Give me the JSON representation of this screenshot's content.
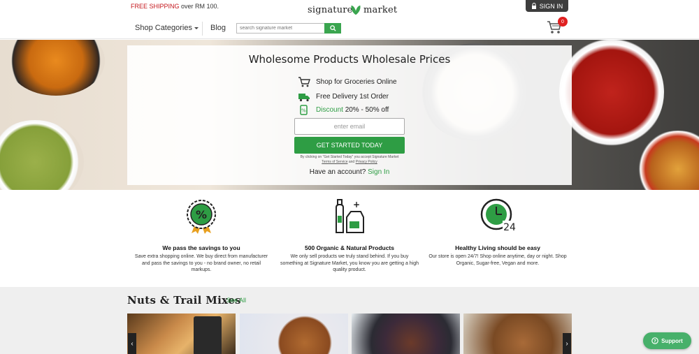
{
  "colors": {
    "brand_green": "#2e9d44",
    "promo_red": "#c4161c",
    "badge_red": "#e02020",
    "dark": "#3d3d3d"
  },
  "header": {
    "promo_prefix": "FREE SHIPPING",
    "promo_suffix": "over RM 100.",
    "logo_left": "signature",
    "logo_right": "market",
    "signin_label": "SIGN IN",
    "categories_label": "Shop Categories",
    "blog_label": "Blog",
    "search_placeholder": "search signature market",
    "cart_count": "0"
  },
  "hero": {
    "title": "Wholesome Products Wholesale Prices",
    "features": [
      {
        "icon": "cart-icon",
        "text": "Shop for Groceries Online"
      },
      {
        "icon": "truck-icon",
        "text": "Free Delivery 1st Order"
      },
      {
        "icon": "discount-tag-icon",
        "highlight": "Discount",
        "text": "20% - 50% off"
      }
    ],
    "email_placeholder": "enter email",
    "cta_label": "GET STARTED TODAY",
    "fine_print": "By clicking on \"Get Started Today\" you accept Signature Market",
    "terms_label": "Terms of Service",
    "and_label": "and",
    "privacy_label": "Privacy Policy",
    "have_account": "Have an account?",
    "signin_link": "Sign In"
  },
  "benefits": [
    {
      "icon": "percent-badge-icon",
      "title": "We pass the savings to you",
      "text": "Save extra shopping online. We buy direct from manufacturer and pass the savings to you - no brand owner, no retail markups."
    },
    {
      "icon": "organic-products-icon",
      "title": "500 Organic & Natural Products",
      "text": "We only sell products we truly stand behind. If you buy something at Signature Market, you know you are getting a high quality product."
    },
    {
      "icon": "clock-24-icon",
      "title": "Healthy Living should be easy",
      "text": "Our store is open 24/7! Shop online anytime, day or night. Shop Organic, Sugar-free, Vegan and more."
    }
  ],
  "products": {
    "title": "Nuts & Trail Mixes",
    "see_all": "See All",
    "prev_label": "‹",
    "next_label": "›"
  },
  "support_label": "Support"
}
